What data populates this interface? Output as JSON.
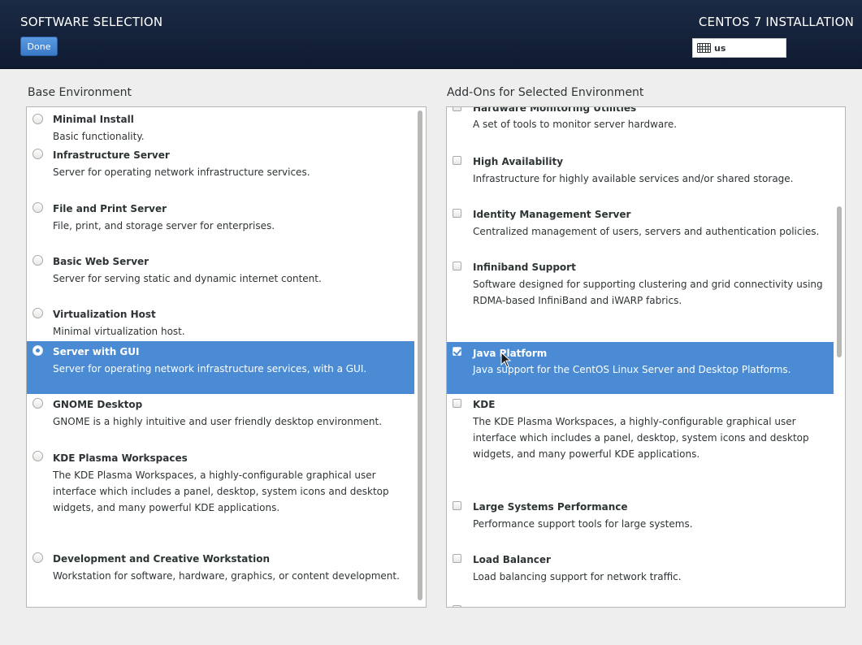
{
  "header": {
    "spoke_title": "SOFTWARE SELECTION",
    "done_label": "Done",
    "install_title": "CENTOS 7 INSTALLATION",
    "keyboard_icon": "keyboard-icon",
    "keyboard_layout": "us"
  },
  "base_environment": {
    "title": "Base Environment",
    "items": [
      {
        "title": "Minimal Install",
        "desc": "Basic functionality.",
        "selected": false
      },
      {
        "title": "Infrastructure Server",
        "desc": "Server for operating network infrastructure services.",
        "selected": false
      },
      {
        "title": "File and Print Server",
        "desc": "File, print, and storage server for enterprises.",
        "selected": false
      },
      {
        "title": "Basic Web Server",
        "desc": "Server for serving static and dynamic internet content.",
        "selected": false
      },
      {
        "title": "Virtualization Host",
        "desc": "Minimal virtualization host.",
        "selected": false
      },
      {
        "title": "Server with GUI",
        "desc": "Server for operating network infrastructure services, with a GUI.",
        "selected": true
      },
      {
        "title": "GNOME Desktop",
        "desc": "GNOME is a highly intuitive and user friendly desktop environment.",
        "selected": false
      },
      {
        "title": "KDE Plasma Workspaces",
        "desc": "The KDE Plasma Workspaces, a highly-configurable graphical user interface which includes a panel, desktop, system icons and desktop widgets, and many powerful KDE applications.",
        "selected": false
      },
      {
        "title": "Development and Creative Workstation",
        "desc": "Workstation for software, hardware, graphics, or content development.",
        "selected": false
      }
    ]
  },
  "addons": {
    "title": "Add-Ons for Selected Environment",
    "items": [
      {
        "title": "Hardware Monitoring Utilities",
        "desc": "A set of tools to monitor server hardware.",
        "checked": false
      },
      {
        "title": "High Availability",
        "desc": "Infrastructure for highly available services and/or shared storage.",
        "checked": false
      },
      {
        "title": "Identity Management Server",
        "desc": "Centralized management of users, servers and authentication policies.",
        "checked": false
      },
      {
        "title": "Infiniband Support",
        "desc": "Software designed for supporting clustering and grid connectivity using RDMA-based InfiniBand and iWARP fabrics.",
        "checked": false
      },
      {
        "title": "Java Platform",
        "desc": "Java support for the CentOS Linux Server and Desktop Platforms.",
        "checked": true
      },
      {
        "title": "KDE",
        "desc": "The KDE Plasma Workspaces, a highly-configurable graphical user interface which includes a panel, desktop, system icons and desktop widgets, and many powerful KDE applications.",
        "checked": false
      },
      {
        "title": "Large Systems Performance",
        "desc": "Performance support tools for large systems.",
        "checked": false
      },
      {
        "title": "Load Balancer",
        "desc": "Load balancing support for network traffic.",
        "checked": false
      }
    ]
  },
  "colors": {
    "header_bg": "#142340",
    "selection": "#4a8bd4",
    "done_button": "#4a8bd4"
  }
}
